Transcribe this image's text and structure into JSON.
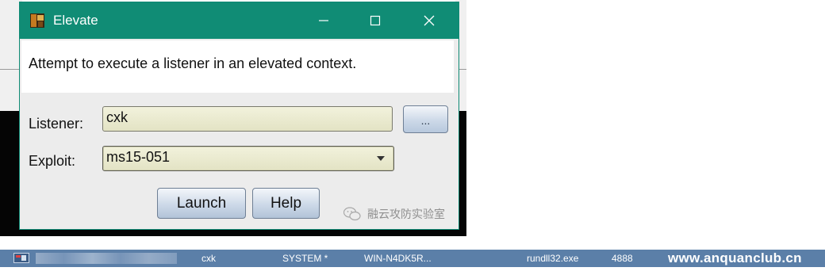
{
  "window": {
    "title": "Elevate",
    "description": "Attempt to execute a listener in an elevated context.",
    "controls": {
      "minimize_icon": "minimize-icon",
      "maximize_icon": "maximize-icon",
      "close_icon": "close-icon"
    }
  },
  "form": {
    "listener_label": "Listener:",
    "listener_value": "cxk",
    "browse_label": "...",
    "exploit_label": "Exploit:",
    "exploit_value": "ms15-051"
  },
  "buttons": {
    "launch_label": "Launch",
    "help_label": "Help"
  },
  "watermark": {
    "text": "融云攻防实验室"
  },
  "session_row": {
    "user": "cxk",
    "account": "SYSTEM *",
    "computer": "WIN-N4DK5R...",
    "process": "rundll32.exe",
    "pid": "4888",
    "overlay_text": "www.anquanclub.cn"
  },
  "colors": {
    "titlebar": "#108c75",
    "session_row": "#5b7fa8"
  }
}
